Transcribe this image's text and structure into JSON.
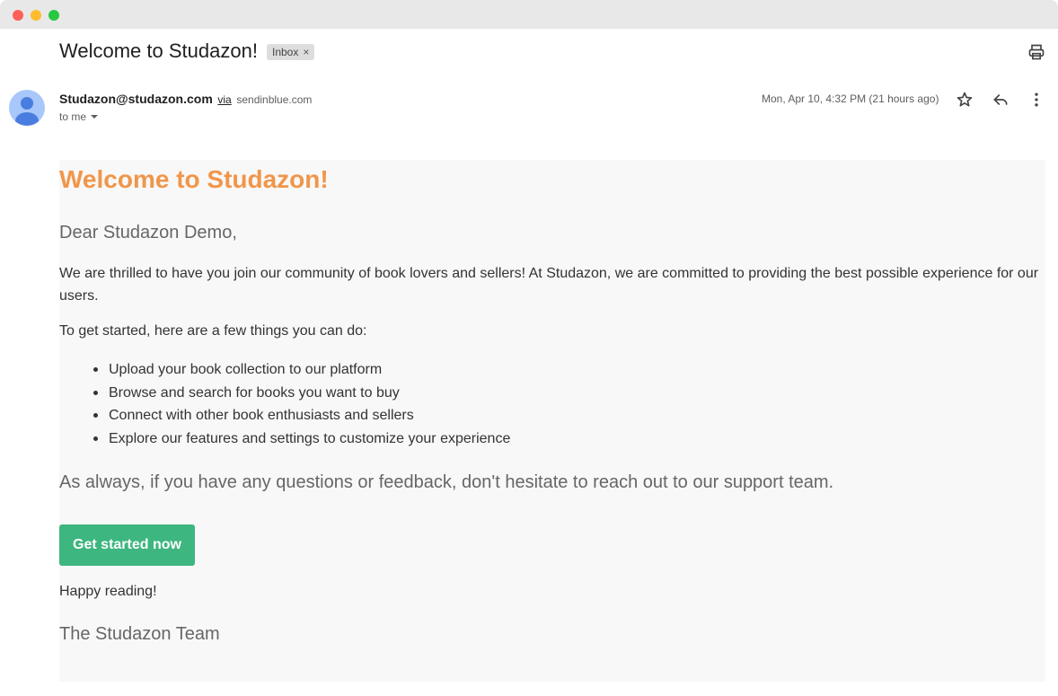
{
  "window": {
    "controls": [
      "close",
      "minimize",
      "maximize"
    ]
  },
  "header": {
    "subject": "Welcome to Studazon!",
    "label_chip": "Inbox",
    "label_chip_remove": "×",
    "print_icon": "printer-icon"
  },
  "message": {
    "sender_email": "Studazon@studazon.com",
    "via_label": "via",
    "via_domain": "sendinblue.com",
    "recipient": "to me",
    "date": "Mon, Apr 10, 4:32 PM (21 hours ago)",
    "actions": {
      "star_icon": "star-icon",
      "reply_icon": "reply-icon",
      "more_icon": "more-vertical-icon"
    }
  },
  "email_body": {
    "title": "Welcome to Studazon!",
    "greeting": "Dear Studazon Demo,",
    "paragraph1": "We are thrilled to have you join our community of book lovers and sellers! At Studazon, we are committed to providing the best possible experience for our users.",
    "paragraph2": "To get started, here are a few things you can do:",
    "list": [
      "Upload your book collection to our platform",
      "Browse and search for books you want to buy",
      "Connect with other book enthusiasts and sellers",
      "Explore our features and settings to customize your experience"
    ],
    "closing": "As always, if you have any questions or feedback, don't hesitate to reach out to our support team.",
    "cta_label": "Get started now",
    "sign_off": "Happy reading!",
    "signature": "The Studazon Team"
  },
  "colors": {
    "title_accent": "#f0964a",
    "cta_background": "#3db67f",
    "body_background": "#f8f8f8"
  }
}
